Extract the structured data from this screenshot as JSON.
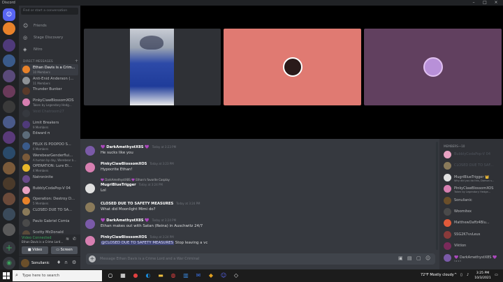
{
  "window": {
    "title": "Discord"
  },
  "sidebar": {
    "search_placeholder": "Find or start a conversation",
    "nav": [
      {
        "label": "Friends",
        "icon": "friends-icon"
      },
      {
        "label": "Stage Discovery",
        "icon": "stage-icon"
      },
      {
        "label": "Nitro",
        "icon": "nitro-icon"
      }
    ],
    "dm_header": "DIRECT MESSAGES",
    "dms": [
      {
        "name": "Ethan Davis is a Crim...",
        "sub": "10 Members",
        "color": "#e8822a",
        "active": true
      },
      {
        "name": "Anti-Enid Anderson (...",
        "sub": "11 Members",
        "color": "#8e9297"
      },
      {
        "name": "Thunder Bunker",
        "sub": "",
        "color": "#5a3a2a"
      },
      {
        "name": "PinkyClawBlossomXOS",
        "sub": "Taken by Legendary Hedg...",
        "color": "#d77fb1"
      },
      {
        "name": "Void Chatroom27",
        "sub": "",
        "color": "#36393f",
        "faded": true
      },
      {
        "name": "Limit Breakers",
        "sub": "9 Members",
        "color": "#4f3a7a"
      },
      {
        "name": "Edward π",
        "sub": "",
        "color": "#5c6b7a"
      },
      {
        "name": "FELIX IS POOPOO S...",
        "sub": "6 Members",
        "color": "#3a5a8a"
      },
      {
        "name": "WerebearGenderflui...",
        "sub": "A human by day, Werebear b...",
        "color": "#7a5a3a"
      },
      {
        "name": "OPERATION: Lure Et...",
        "sub": "4 Members",
        "color": "#e8b82a"
      },
      {
        "name": "Natroninite",
        "sub": "",
        "color": "#6a4a8a"
      },
      {
        "name": "BubblyCodaPop-V 04",
        "sub": "",
        "color": "#e8a2c2"
      },
      {
        "name": "Operation: Destroy D...",
        "sub": "5 Members",
        "color": "#e8822a"
      },
      {
        "name": "CLOSED DUE TO SA...",
        "sub": "",
        "color": "#8a7a5a"
      },
      {
        "name": "Paulo Gabriel Comia",
        "sub": "",
        "color": "#4a4a4a"
      },
      {
        "name": "Scotty McDonald",
        "sub": "",
        "color": "#5a4a3a"
      }
    ],
    "voice": {
      "status": "Video Connected",
      "channel": "Ethan Davis is a Crime Lord...",
      "video_label": "Video",
      "screen_label": "Screen"
    },
    "user": {
      "name": "Sonulianic"
    }
  },
  "chat": {
    "messages": [
      {
        "author": "💜 DarkAmethystX8S 💜",
        "time": "Today at 3:23 PM",
        "text": "He sucks like you",
        "color": "#7a5aa8"
      },
      {
        "author": "PinkyClawBlossomXOS",
        "time": "Today at 3:23 PM",
        "text": "Hypocrite Ethan!",
        "color": "#d77fb1"
      },
      {
        "author": "MugriBlueTrigger",
        "time": "Today at 3:24 PM",
        "text": "Lol",
        "color": "#e0e0e0",
        "reply": "💜 DarkAmethystX8S 💜 Ethan's favorite Cosplay"
      },
      {
        "author": "CLOSED DUE TO SAFETY MEASURES",
        "time": "Today at 3:24 PM",
        "text": "What did Moonlight Mimi do?",
        "color": "#8a7a5a"
      },
      {
        "author": "💜 DarkAmethystX8S 💜",
        "time": "Today at 3:24 PM",
        "text": "Ethan makes out with Satan (Reina) in Auschwitz 24/7",
        "color": "#7a5aa8"
      },
      {
        "author": "PinkyClawBlossomXOS",
        "time": "Today at 3:24 PM",
        "text": "Stop leaving a vc",
        "mention": "@CLOSED DUE TO SAFETY MEASURES",
        "color": "#d77fb1"
      }
    ],
    "composer_placeholder": "Message Ethan Davis is a Crime Lord and a War Criminal"
  },
  "members": {
    "header": "MEMBERS—10",
    "list": [
      {
        "name": "BubblyCodaPop-V 04",
        "color": "#e8a2c2",
        "off": true
      },
      {
        "name": "CLOSED DUE TO SAF...",
        "color": "#8a7a5a",
        "off": true
      },
      {
        "name": "MugriBlueTrigger 👑",
        "sub": "Why did you do this, Damon s...",
        "color": "#e0e0e0"
      },
      {
        "name": "PinkyClawBlossomXOS",
        "sub": "Taken by Legendary Hedge...",
        "color": "#d77fb1"
      },
      {
        "name": "Sonulianic",
        "color": "#6b4f2a"
      },
      {
        "name": "Woomitex",
        "color": "#4a4a4a"
      },
      {
        "name": "MatthewDaffz4Blu...",
        "color": "#e05a3a"
      },
      {
        "name": "SSG2K7vvLeus",
        "color": "#8a3a3a"
      },
      {
        "name": "Viktion",
        "color": "#7a2a5a"
      },
      {
        "name": "💜 DarkAmethystX8S 💜",
        "sub": "l o s t",
        "color": "#7a5aa8"
      }
    ]
  },
  "taskbar": {
    "search_placeholder": "Type here to search",
    "weather": "72°F  Mostly cloudy",
    "time": "3:25 PM",
    "date": "10/3/2021"
  }
}
